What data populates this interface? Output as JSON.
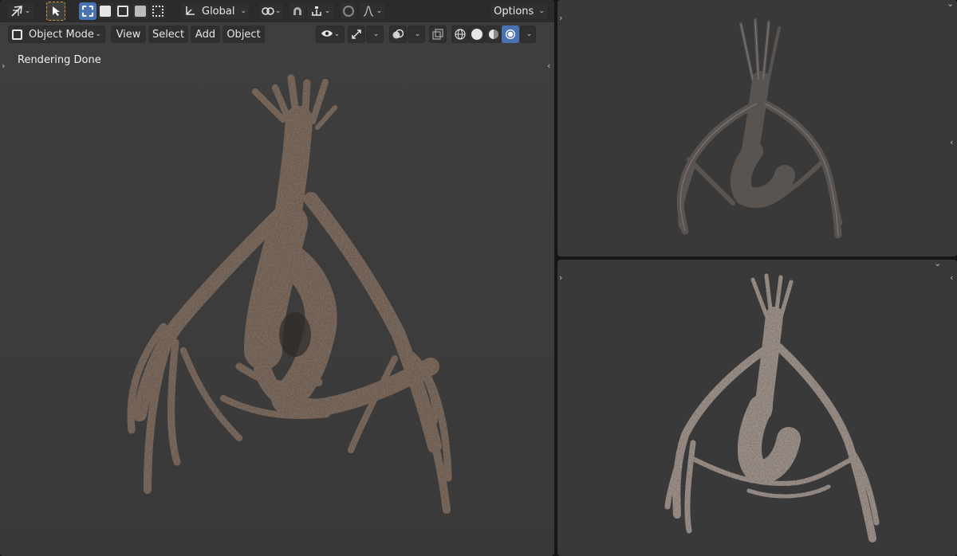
{
  "header": {
    "transform_orientation": "Global",
    "options_label": "Options"
  },
  "view_header": {
    "mode_label": "Object Mode",
    "menus": [
      "View",
      "Select",
      "Add",
      "Object"
    ]
  },
  "viewport": {
    "status_message": "Rendering Done"
  },
  "icons": {
    "tool_cursor": "move-cursor-icon",
    "select_box": "select-box-icon",
    "snap": "magnet-icon",
    "proportional": "proportional-edit-icon",
    "visibility": "eye-icon",
    "gizmo": "gizmo-icon",
    "overlay": "overlay-icon",
    "xray": "xray-icon",
    "shading_wire": "wireframe-shading-icon",
    "shading_solid": "solid-shading-icon",
    "shading_material": "material-shading-icon",
    "shading_rendered": "rendered-shading-icon"
  },
  "colors": {
    "accent": "#4772b3",
    "header_bg": "#2b2b2b",
    "viewport_bg": "#3d3d3d"
  }
}
